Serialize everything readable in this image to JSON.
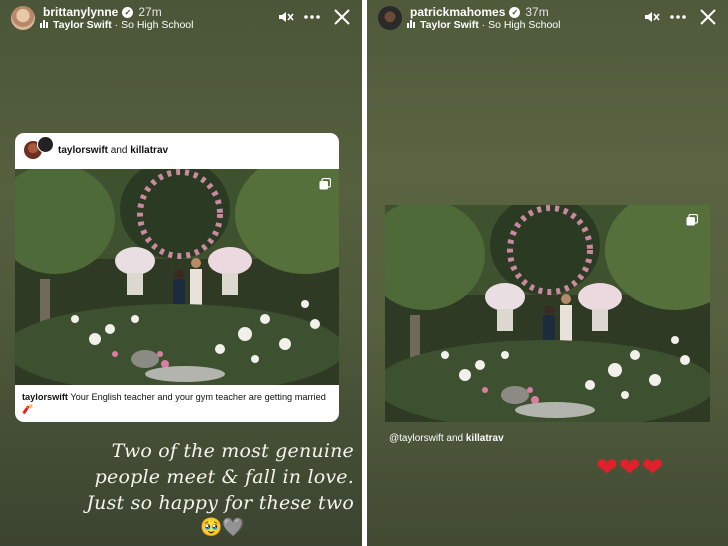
{
  "left_story": {
    "username": "brittanylynne",
    "time": "27m",
    "music_artist": "Taylor Swift",
    "music_song": "So High School",
    "post_card": {
      "account1": "taylorswift",
      "and_text": "and",
      "account2": "killatrav",
      "caption_user": "taylorswift",
      "caption_text": "Your English teacher and your gym teacher are getting married 🧨"
    },
    "handwriting_lines": [
      "Two of the most genuine",
      "people meet & fall in love.",
      "Just so happy for these two"
    ],
    "emojis": "🥹🩶"
  },
  "right_story": {
    "username": "patrickmahomes",
    "time": "37m",
    "music_artist": "Taylor Swift",
    "music_song": "So High School",
    "mention": "@taylorswift",
    "and_text": "and",
    "mention2": "killatrav",
    "hearts": [
      "❤",
      "❤",
      "❤"
    ]
  },
  "icons": {
    "mute": "speaker-muted-icon",
    "more": "more-horizontal-icon",
    "close": "close-icon",
    "carousel": "multiple-posts-icon"
  },
  "colors": {
    "story_bg": "#4d583a",
    "heart": "#e0202a"
  }
}
